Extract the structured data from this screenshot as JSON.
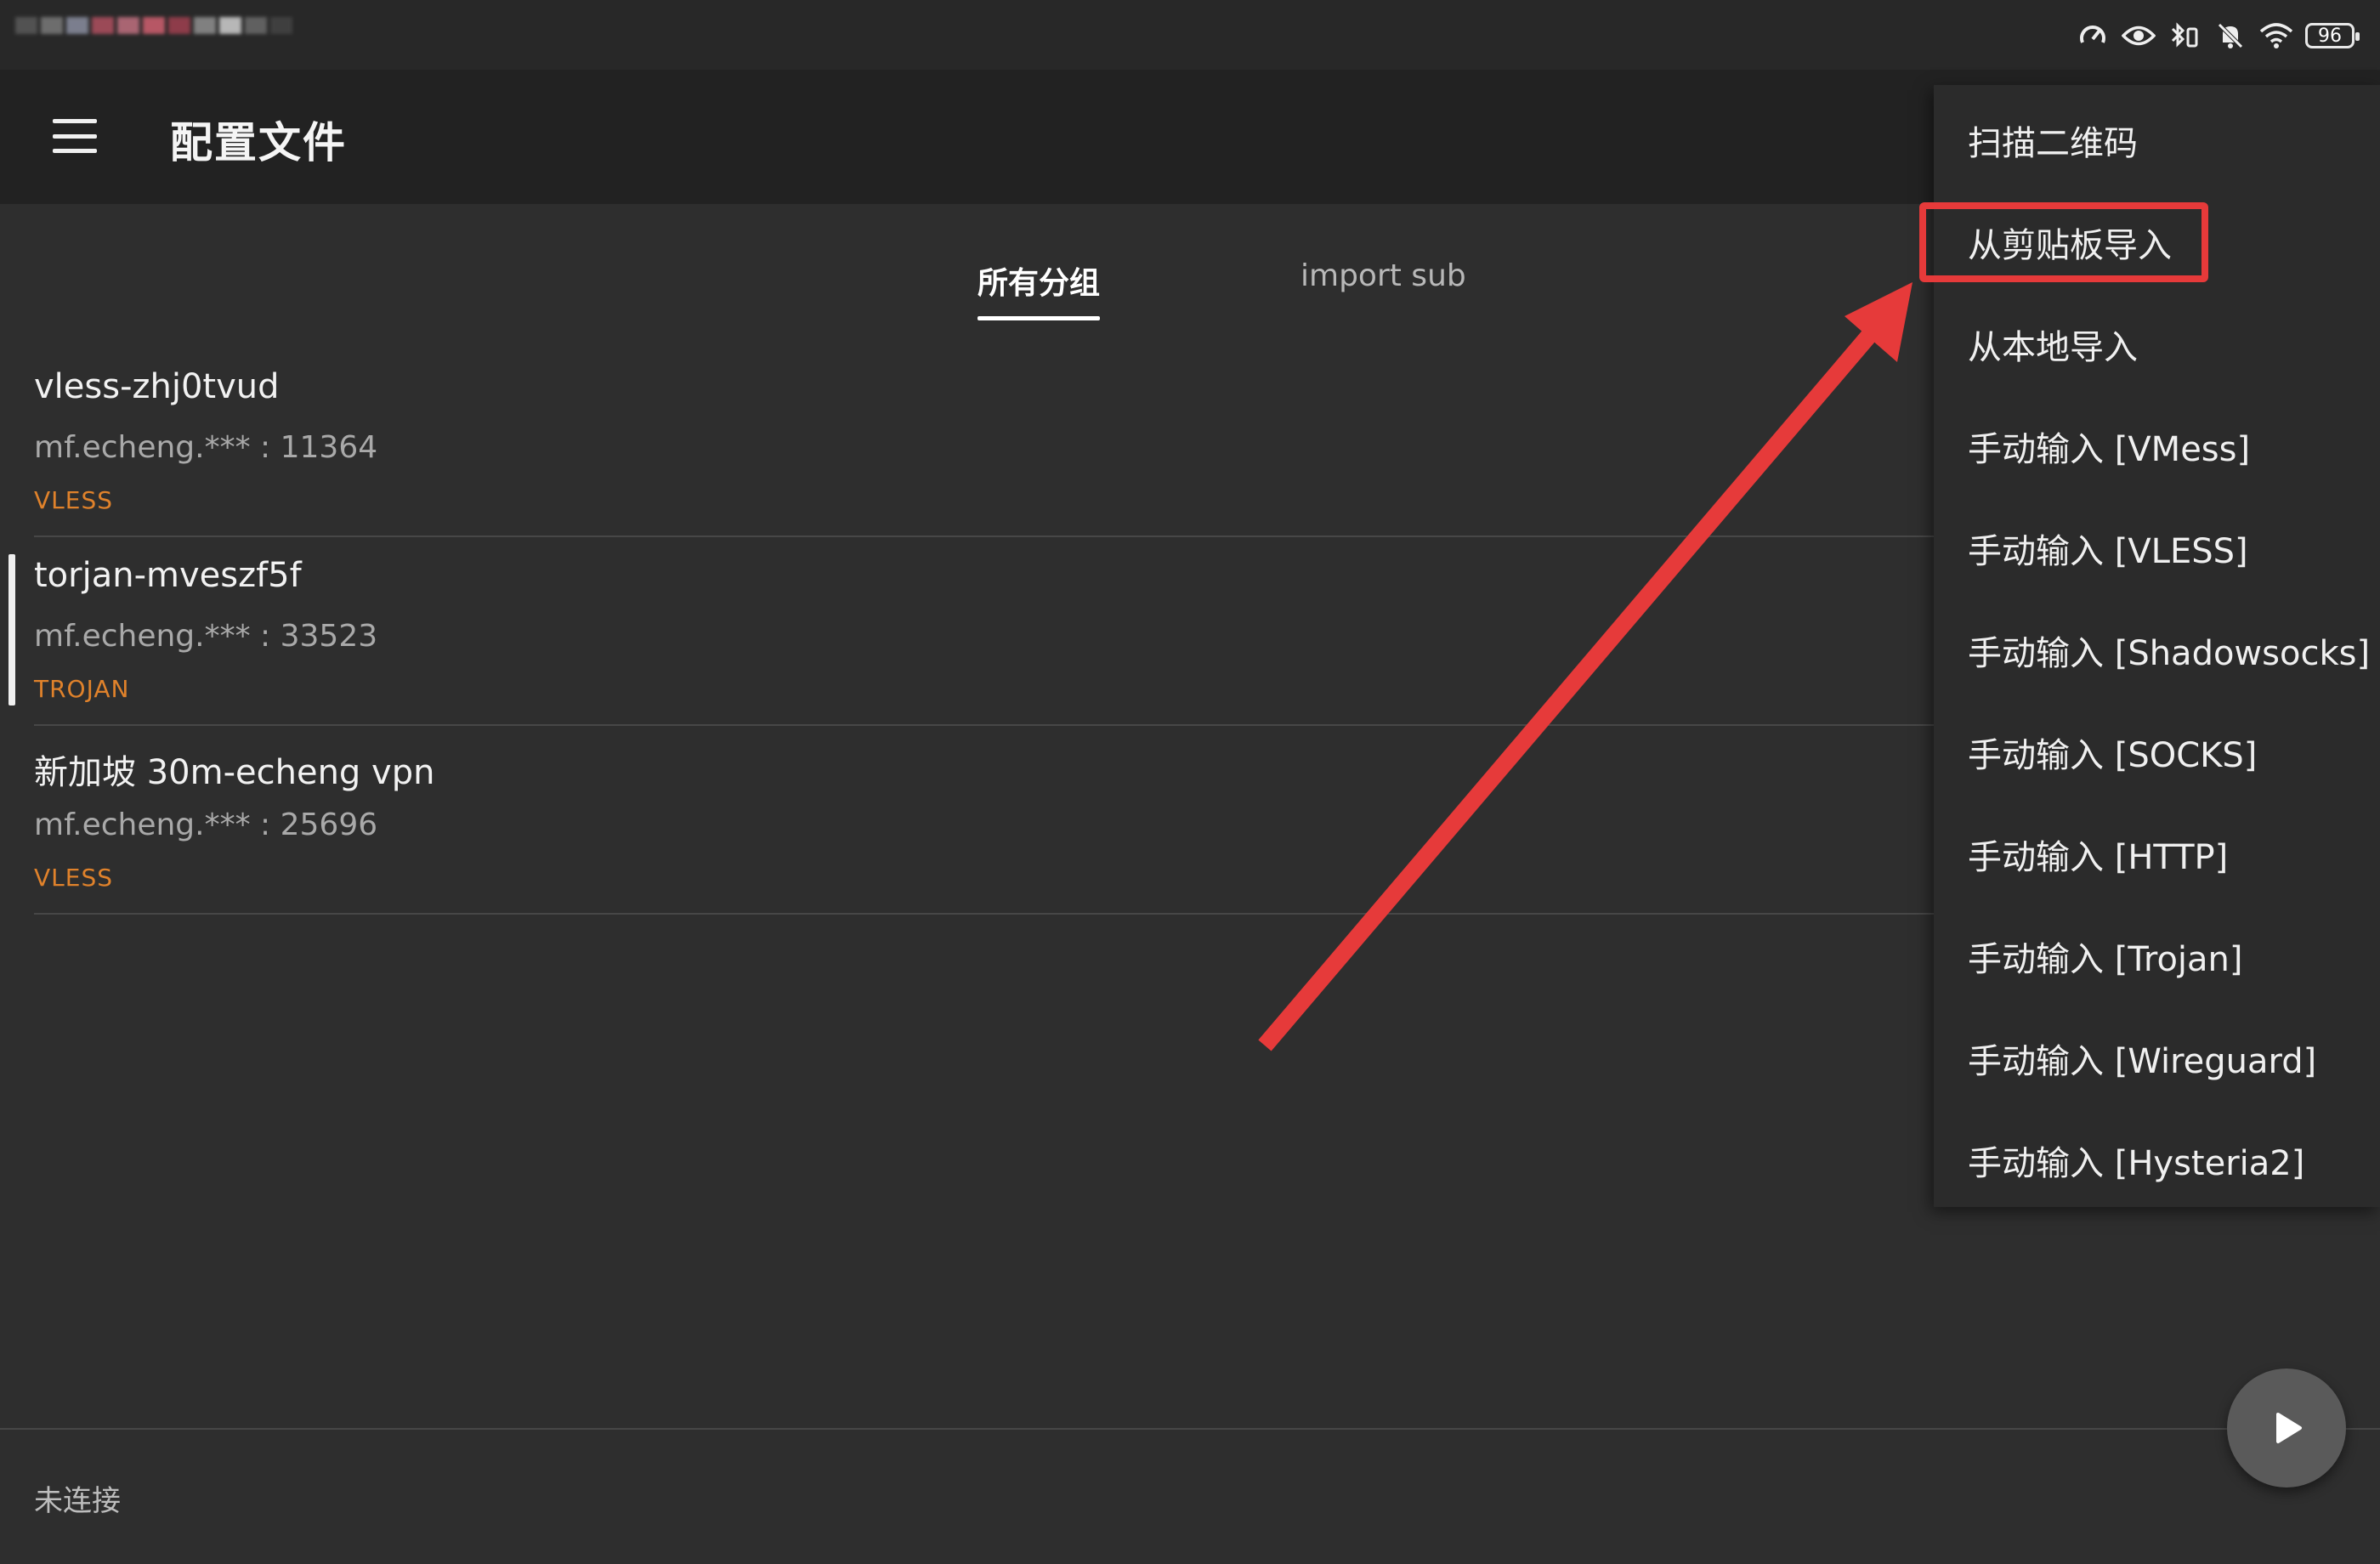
{
  "status_bar": {
    "battery": "96",
    "icons": [
      "speedometer-icon",
      "eye-icon",
      "bluetooth-battery-icon",
      "bell-off-icon",
      "wifi-icon"
    ]
  },
  "toolbar": {
    "title": "配置文件",
    "menu_icon": "hamburger-menu-icon"
  },
  "tabs": [
    {
      "label": "所有分组",
      "active": true
    },
    {
      "label": "import sub",
      "active": false
    }
  ],
  "profiles": [
    {
      "name": "vless-zhj0tvud",
      "address": "mf.echeng.*** : 11364",
      "type": "VLESS",
      "selected": false
    },
    {
      "name": "torjan-mveszf5f",
      "address": "mf.echeng.*** : 33523",
      "type": "TROJAN",
      "selected": true
    },
    {
      "name": "新加坡 30m-echeng vpn",
      "address": "mf.echeng.*** : 25696",
      "type": "VLESS",
      "selected": false
    }
  ],
  "connection_status": "未连接",
  "fab_icon": "play-icon",
  "dropdown": {
    "items": [
      "扫描二维码",
      "从剪贴板导入",
      "从本地导入",
      "手动输入 [VMess]",
      "手动输入 [VLESS]",
      "手动输入 [Shadowsocks]",
      "手动输入 [SOCKS]",
      "手动输入 [HTTP]",
      "手动输入 [Trojan]",
      "手动输入 [Wireguard]",
      "手动输入 [Hysteria2]"
    ],
    "highlighted_index": 1
  },
  "colors": {
    "accent_protocol": "#e0822b",
    "annotation_red": "#e63a3a",
    "background": "#2e2e2e",
    "toolbar": "#222222"
  }
}
